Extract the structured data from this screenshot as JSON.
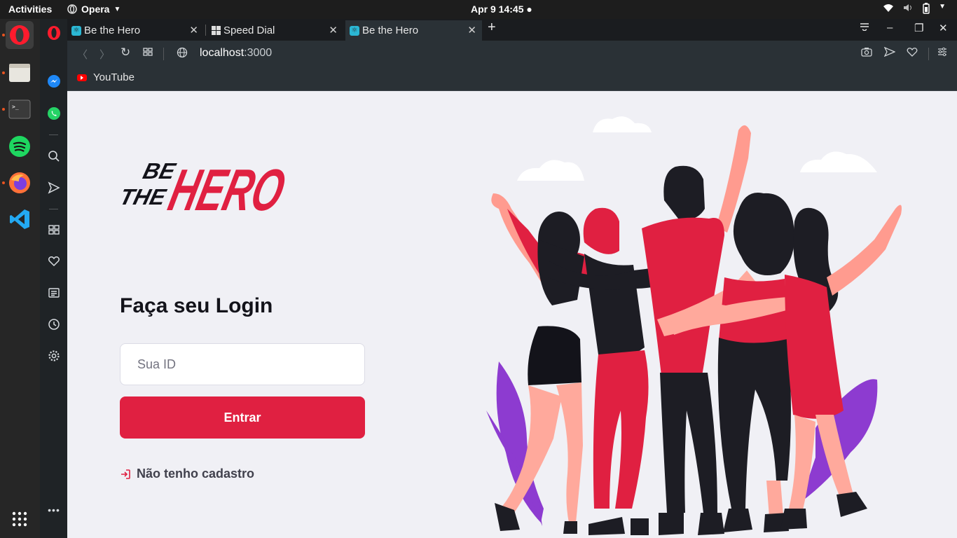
{
  "topbar": {
    "activities": "Activities",
    "app_name": "Opera",
    "clock": "Apr 9  14:45"
  },
  "tabs": [
    {
      "title": "Be the Hero",
      "active": false
    },
    {
      "title": "Speed Dial",
      "active": false
    },
    {
      "title": "Be the Hero",
      "active": true
    }
  ],
  "address": {
    "host": "localhost",
    "port": ":3000"
  },
  "bookmarks": [
    {
      "label": "YouTube"
    }
  ],
  "page": {
    "logo_line1": "BE",
    "logo_line2": "THE",
    "logo_hero": "HERO",
    "login_title": "Faça seu Login",
    "id_placeholder": "Sua ID",
    "enter_label": "Entrar",
    "register_link": "Não tenho cadastro"
  },
  "colors": {
    "brand": "#e02041",
    "page_bg": "#f0f0f5",
    "title": "#13131a",
    "text": "#41414d"
  },
  "icons": {
    "dock": [
      "opera-icon",
      "files-icon",
      "terminal-icon",
      "spotify-icon",
      "firefox-icon",
      "vscode-icon",
      "app-grid-icon"
    ],
    "opera_sidebar": [
      "opera-logo-icon",
      "messenger-icon",
      "whatsapp-icon",
      "search-icon",
      "send-icon",
      "speed-dial-icon",
      "heart-icon",
      "news-icon",
      "history-icon",
      "settings-icon",
      "more-icon"
    ]
  }
}
